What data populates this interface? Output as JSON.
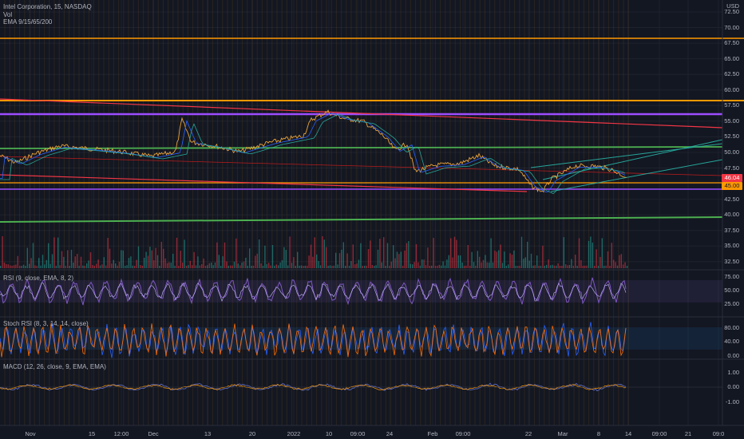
{
  "header": {
    "symbol": "Intel Corporation, 15, NASDAQ",
    "currency": "USD",
    "vol": "Vol",
    "ema": "EMA 9/15/65/200"
  },
  "indicators": {
    "rsi": "RSI (9, close, EMA, 8, 2)",
    "stoch": "Stoch RSI (8, 3, 14, 14, close)",
    "macd": "MACD (12, 26, close, 9, EMA, EMA)"
  },
  "price_axis": [
    "72.50",
    "70.00",
    "67.50",
    "65.00",
    "62.50",
    "60.00",
    "57.50",
    "55.00",
    "52.50",
    "50.00",
    "47.50",
    "45.00",
    "42.50",
    "40.00",
    "37.50",
    "35.00",
    "32.50"
  ],
  "rsi_axis": [
    "75.00",
    "50.00",
    "25.00"
  ],
  "stoch_axis": [
    "80.00",
    "40.00",
    "0.00"
  ],
  "macd_axis": [
    "1.00",
    "0.00",
    "-1.00"
  ],
  "time_axis": [
    "Nov",
    "15",
    "12:00",
    "Dec",
    "13",
    "20",
    "2022",
    "10",
    "09:00",
    "24",
    "Feb",
    "09:00",
    "22",
    "Mar",
    "8",
    "14",
    "09:00",
    "21",
    "09:0"
  ],
  "last_price": "46.04",
  "badge_price_2": "45.00",
  "colors": {
    "background": "#131722",
    "orange": "#ff9800",
    "purple": "#9c4dff",
    "green": "#4caf50",
    "red": "#f23645",
    "teal": "#26a69a",
    "rsi": "#7e57c2",
    "stoch_k": "#2962ff",
    "stoch_d": "#ff6d00"
  }
}
